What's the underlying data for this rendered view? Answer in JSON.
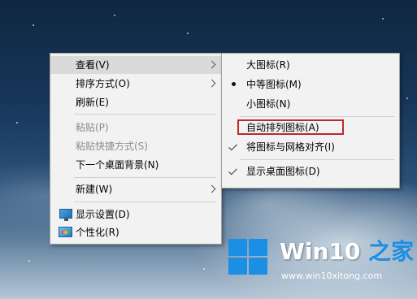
{
  "context_menu": {
    "items": [
      {
        "label": "查看(V)"
      },
      {
        "label": "排序方式(O)"
      },
      {
        "label": "刷新(E)"
      },
      {
        "label": "粘贴(P)"
      },
      {
        "label": "粘贴快捷方式(S)"
      },
      {
        "label": "下一个桌面背景(N)"
      },
      {
        "label": "新建(W)"
      },
      {
        "label": "显示设置(D)",
        "icon": "display-settings-icon"
      },
      {
        "label": "个性化(R)",
        "icon": "personalize-icon"
      }
    ]
  },
  "view_submenu": {
    "items": [
      {
        "label": "大图标(R)"
      },
      {
        "label": "中等图标(M)",
        "selected": true
      },
      {
        "label": "小图标(N)"
      },
      {
        "label": "自动排列图标(A)",
        "highlighted_box": true
      },
      {
        "label": "将图标与网格对齐(I)",
        "checked": true
      },
      {
        "label": "显示桌面图标(D)",
        "checked": true
      }
    ]
  },
  "watermark": {
    "title_part1": "Win10",
    "title_part2": " 之家",
    "url": "www.win10xitong.com"
  },
  "colors": {
    "menu_bg": "#f2f2f2",
    "highlight_bg": "#dadada",
    "annotation_box": "#c0282d",
    "brand_blue": "#1a8fe3"
  }
}
